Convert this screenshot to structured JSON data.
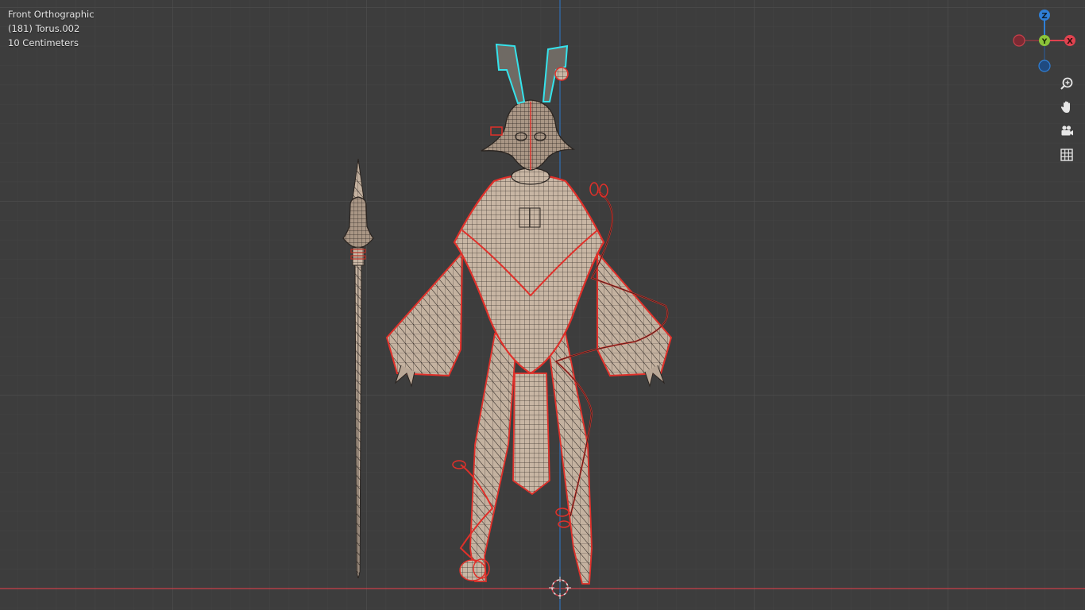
{
  "viewport": {
    "view_name": "Front Orthographic",
    "active_object": "(181) Torus.002",
    "grid_scale": "10 Centimeters"
  },
  "gizmo": {
    "axes": [
      {
        "name": "z-axis",
        "label": "Z",
        "color": "#2f7fd6"
      },
      {
        "name": "y-axis",
        "label": "Y",
        "color": "#8bc43a"
      },
      {
        "name": "x-axis",
        "label": "X",
        "color": "#e0424f"
      },
      {
        "name": "neg-x-axis",
        "label": "",
        "color": "#b13a45"
      },
      {
        "name": "neg-z-axis",
        "label": "",
        "color": "#2a5c9a"
      }
    ]
  },
  "nav_controls": [
    {
      "name": "zoom-icon"
    },
    {
      "name": "pan-hand-icon"
    },
    {
      "name": "camera-view-icon"
    },
    {
      "name": "ortho-grid-icon"
    }
  ],
  "colors": {
    "background": "#3d3d3d",
    "grid_minor": "#454545",
    "grid_major": "#505050",
    "x_axis_line": "#c9404a",
    "z_axis_line": "#2f6fb5",
    "mesh_fill": "#c7b5a4",
    "mesh_wire": "#3a3a3a",
    "selection_outline": "#e0302a",
    "active_selection": "#35e3ec"
  }
}
